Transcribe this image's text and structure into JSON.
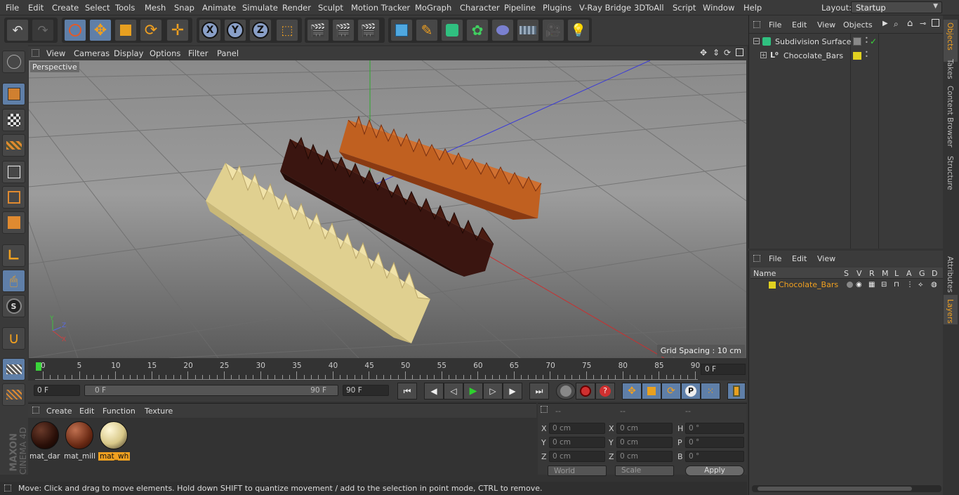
{
  "menubar": {
    "items": [
      "File",
      "Edit",
      "Create",
      "Select",
      "Tools",
      "Mesh",
      "Snap",
      "Animate",
      "Simulate",
      "Render",
      "Sculpt",
      "Motion Tracker",
      "MoGraph",
      "Character",
      "Pipeline",
      "Plugins",
      "V-Ray Bridge",
      "3DToAll",
      "Script",
      "Window",
      "Help"
    ],
    "layout_label": "Layout:",
    "layout_value": "Startup"
  },
  "viewport": {
    "menu": [
      "View",
      "Cameras",
      "Display",
      "Options",
      "Filter",
      "Panel"
    ],
    "camera_label": "Perspective",
    "grid_spacing": "Grid Spacing : 10 cm",
    "axis_labels": [
      "Y",
      "Z",
      "X"
    ]
  },
  "timeline": {
    "ticks": [
      "0",
      "5",
      "10",
      "15",
      "20",
      "25",
      "30",
      "35",
      "40",
      "45",
      "50",
      "55",
      "60",
      "65",
      "70",
      "75",
      "80",
      "85",
      "90"
    ],
    "current_frame": "0 F"
  },
  "transport": {
    "start_frame": "0 F",
    "range_start": "0 F",
    "range_end": "90 F",
    "end_frame": "90 F"
  },
  "materials": {
    "menu": [
      "Create",
      "Edit",
      "Function",
      "Texture"
    ],
    "items": [
      {
        "name": "mat_dar",
        "color": "#3a1a12"
      },
      {
        "name": "mat_mill",
        "color": "#8a4a2a"
      },
      {
        "name": "mat_wh",
        "color": "#e8d8a0"
      }
    ],
    "selected": "mat_wh"
  },
  "coords": {
    "headers": [
      "--",
      "--",
      "--"
    ],
    "rows": [
      {
        "a": "X",
        "av": "0 cm",
        "b": "X",
        "bv": "0 cm",
        "c": "H",
        "cv": "0 °"
      },
      {
        "a": "Y",
        "av": "0 cm",
        "b": "Y",
        "bv": "0 cm",
        "c": "P",
        "cv": "0 °"
      },
      {
        "a": "Z",
        "av": "0 cm",
        "b": "Z",
        "bv": "0 cm",
        "c": "B",
        "cv": "0 °"
      }
    ],
    "space": "World",
    "mode": "Scale",
    "apply": "Apply"
  },
  "status": "Move: Click and drag to move elements. Hold down SHIFT to quantize movement / add to the selection in point mode, CTRL to remove.",
  "objects": {
    "menu": [
      "File",
      "Edit",
      "View",
      "Objects"
    ],
    "items": [
      {
        "name": "Subdivision Surface",
        "tag_color": "#cccccc"
      },
      {
        "name": "Chocolate_Bars",
        "tag_color": "#e0d020"
      }
    ]
  },
  "layers": {
    "menu": [
      "File",
      "Edit",
      "View"
    ],
    "columns": [
      "Name",
      "S",
      "V",
      "R",
      "M",
      "L",
      "A",
      "G",
      "D"
    ],
    "items": [
      {
        "name": "Chocolate_Bars",
        "color": "#e0d020"
      }
    ]
  },
  "side_tabs_top": [
    "Objects",
    "Takes",
    "Content Browser",
    "Structure"
  ],
  "side_tabs_bottom": [
    "Attributes",
    "Layers"
  ],
  "brand": [
    "MAXON",
    "CINEMA 4D"
  ]
}
